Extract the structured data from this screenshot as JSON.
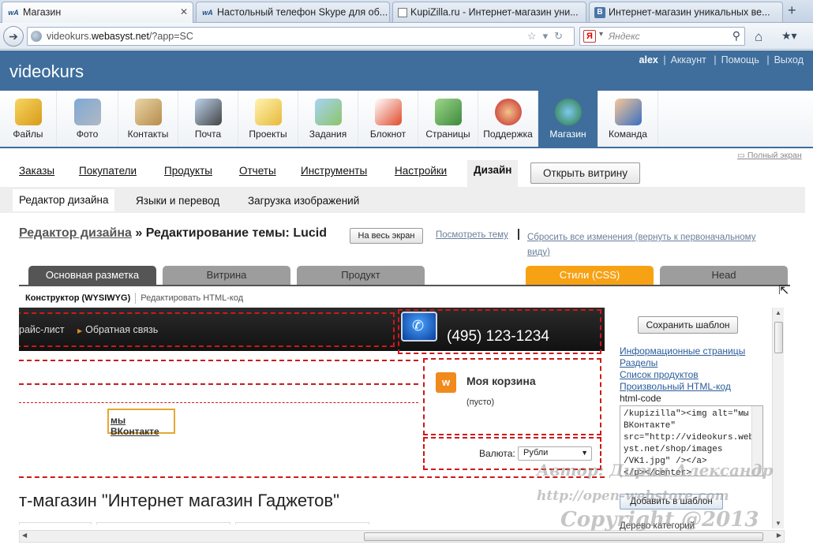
{
  "browser": {
    "tabs": [
      {
        "label": "Магазин",
        "favicon": "WA"
      },
      {
        "label": "Настольный телефон Skype для об...",
        "favicon": "WA"
      },
      {
        "label": "KupiZilla.ru - Интернет-магазин уни...",
        "favicon": "blank"
      },
      {
        "label": "Интернет-магазин уникальных ве...",
        "favicon": "B"
      }
    ],
    "url_prefix": "videokurs.",
    "url_domain": "webasyst.net",
    "url_suffix": "/?app=SC",
    "search_placeholder": "Яндекс",
    "search_engine_badge": "Я"
  },
  "app_header": {
    "brand": "videokurs",
    "username": "alex",
    "links": [
      "Аккаунт",
      "Помощь",
      "Выход"
    ]
  },
  "apps": [
    {
      "label": "Файлы",
      "icon": "files-icon"
    },
    {
      "label": "Фото",
      "icon": "photo-icon"
    },
    {
      "label": "Контакты",
      "icon": "contacts-icon"
    },
    {
      "label": "Почта",
      "icon": "mail-icon"
    },
    {
      "label": "Проекты",
      "icon": "projects-icon"
    },
    {
      "label": "Задания",
      "icon": "tasks-icon"
    },
    {
      "label": "Блокнот",
      "icon": "notepad-icon"
    },
    {
      "label": "Страницы",
      "icon": "pages-icon"
    },
    {
      "label": "Поддержка",
      "icon": "support-icon"
    },
    {
      "label": "Магазин",
      "icon": "shop-globe-icon"
    },
    {
      "label": "Команда",
      "icon": "team-icon"
    }
  ],
  "fullscreen_link": "Полный экран",
  "subnav": {
    "items": [
      "Заказы",
      "Покупатели",
      "Продукты",
      "Отчеты",
      "Инструменты",
      "Настройки",
      "Дизайн"
    ],
    "open_shop_button": "Открыть витрину"
  },
  "subsubnav": {
    "items": [
      "Редактор дизайна",
      "Языки и перевод",
      "Загрузка изображений"
    ]
  },
  "editor": {
    "crumb_link": "Редактор дизайна",
    "crumb_sep": "»",
    "crumb_current": "Редактирование темы: Lucid",
    "fullscreen_button": "На весь экран",
    "view_theme_link": "Посмотреть тему",
    "reset_link": "Сбросить все изменения (вернуть к первоначальному виду)",
    "tabs": [
      "Основная разметка",
      "Витрина",
      "Продукт",
      "Стили (CSS)",
      "Head"
    ],
    "mode_active": "Конструктор (WYSIWYG)",
    "mode_alt": "Редактировать HTML-код"
  },
  "preview": {
    "menu_items": [
      "райс-лист",
      "Обратная связь"
    ],
    "phone": "(495) 123-1234",
    "cart_title": "Моя корзина",
    "cart_empty": "(пусто)",
    "currency_label": "Валюта:",
    "currency_value": "Рубли",
    "vk_link": "мы ВКонтакте",
    "shop_title": "т-магазин \"Интернет магазин Гаджетов\""
  },
  "sidebar": {
    "save_button": "Сохранить шаблон",
    "links": [
      "Информационные страницы",
      "Разделы",
      "Список продуктов",
      "Произвольный HTML-код"
    ],
    "html_code_label": "html-code",
    "code_lines": [
      "/kupizilla\"><img alt=\"мы",
      "ВКонтакте\"",
      "src=\"http://videokurs.webas",
      "yst.net/shop/images",
      "/VK1.jpg\" /></a>",
      "</p></center>"
    ],
    "add_button": "Добавить в шаблон",
    "tree_link": "Дерево категорий"
  },
  "watermark": {
    "line1": "Автор: Дирин Александр",
    "line2": "http://open-webstore.com",
    "line3": "Copyright @2013"
  }
}
